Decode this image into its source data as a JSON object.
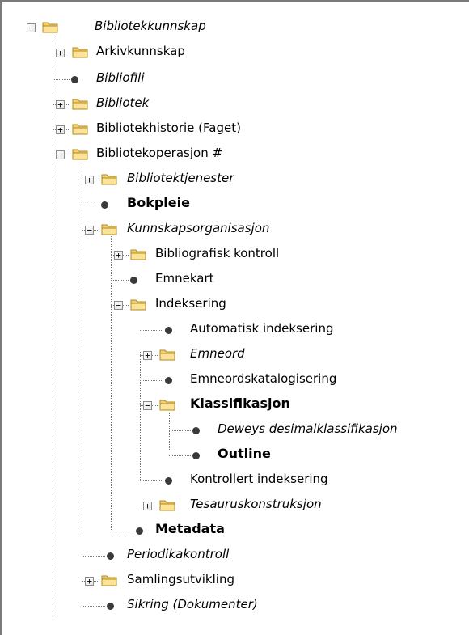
{
  "tree": {
    "nodes": [
      {
        "label": "Bibliotekkunnskap",
        "type": "folder",
        "expanded": true,
        "italic": true,
        "bold": false
      },
      {
        "label": "Arkivkunnskap",
        "type": "folder",
        "expanded": false,
        "italic": false,
        "bold": false
      },
      {
        "label": "Bibliofili",
        "type": "leaf",
        "italic": true,
        "bold": false
      },
      {
        "label": "Bibliotek",
        "type": "folder",
        "expanded": false,
        "italic": true,
        "bold": false
      },
      {
        "label": "Bibliotekhistorie (Faget)",
        "type": "folder",
        "expanded": false,
        "italic": false,
        "bold": false
      },
      {
        "label": "Bibliotekoperasjon #",
        "type": "folder",
        "expanded": true,
        "italic": false,
        "bold": false
      },
      {
        "label": "Bibliotektjenester",
        "type": "folder",
        "expanded": false,
        "italic": true,
        "bold": false
      },
      {
        "label": "Bokpleie",
        "type": "leaf",
        "italic": false,
        "bold": true
      },
      {
        "label": "Kunnskapsorganisasjon",
        "type": "folder",
        "expanded": true,
        "italic": true,
        "bold": false
      },
      {
        "label": "Bibliografisk kontroll",
        "type": "folder",
        "expanded": false,
        "italic": false,
        "bold": false
      },
      {
        "label": "Emnekart",
        "type": "leaf",
        "italic": false,
        "bold": false
      },
      {
        "label": "Indeksering",
        "type": "folder",
        "expanded": true,
        "italic": false,
        "bold": false
      },
      {
        "label": "Automatisk indeksering",
        "type": "leaf",
        "italic": false,
        "bold": false
      },
      {
        "label": "Emneord",
        "type": "folder",
        "expanded": false,
        "italic": true,
        "bold": false
      },
      {
        "label": "Emneordskatalogisering",
        "type": "leaf",
        "italic": false,
        "bold": false
      },
      {
        "label": "Klassifikasjon",
        "type": "folder",
        "expanded": true,
        "italic": false,
        "bold": true
      },
      {
        "label": "Deweys desimalklassifikasjon",
        "type": "leaf",
        "italic": true,
        "bold": false
      },
      {
        "label": "Outline",
        "type": "leaf",
        "italic": false,
        "bold": true
      },
      {
        "label": "Kontrollert indeksering",
        "type": "leaf",
        "italic": false,
        "bold": false
      },
      {
        "label": "Tesauruskonstruksjon",
        "type": "folder",
        "expanded": false,
        "italic": true,
        "bold": false
      },
      {
        "label": "Metadata",
        "type": "leaf",
        "italic": false,
        "bold": true
      },
      {
        "label": "Periodikakontroll",
        "type": "leaf",
        "italic": true,
        "bold": false
      },
      {
        "label": "Samlingsutvikling",
        "type": "folder",
        "expanded": false,
        "italic": false,
        "bold": false
      },
      {
        "label": "Sikring (Dokumenter)",
        "type": "leaf",
        "italic": true,
        "bold": false
      }
    ]
  },
  "colors": {
    "folder_fill": "#f3cf6a",
    "folder_outline": "#b08a24",
    "leaf_dot": "#3a3a3a",
    "tree_lines": "#7a7a7a"
  },
  "icons": {
    "folder": "folder-icon",
    "leaf": "bullet-icon",
    "expanded": "minus-icon",
    "collapsed": "plus-icon"
  }
}
